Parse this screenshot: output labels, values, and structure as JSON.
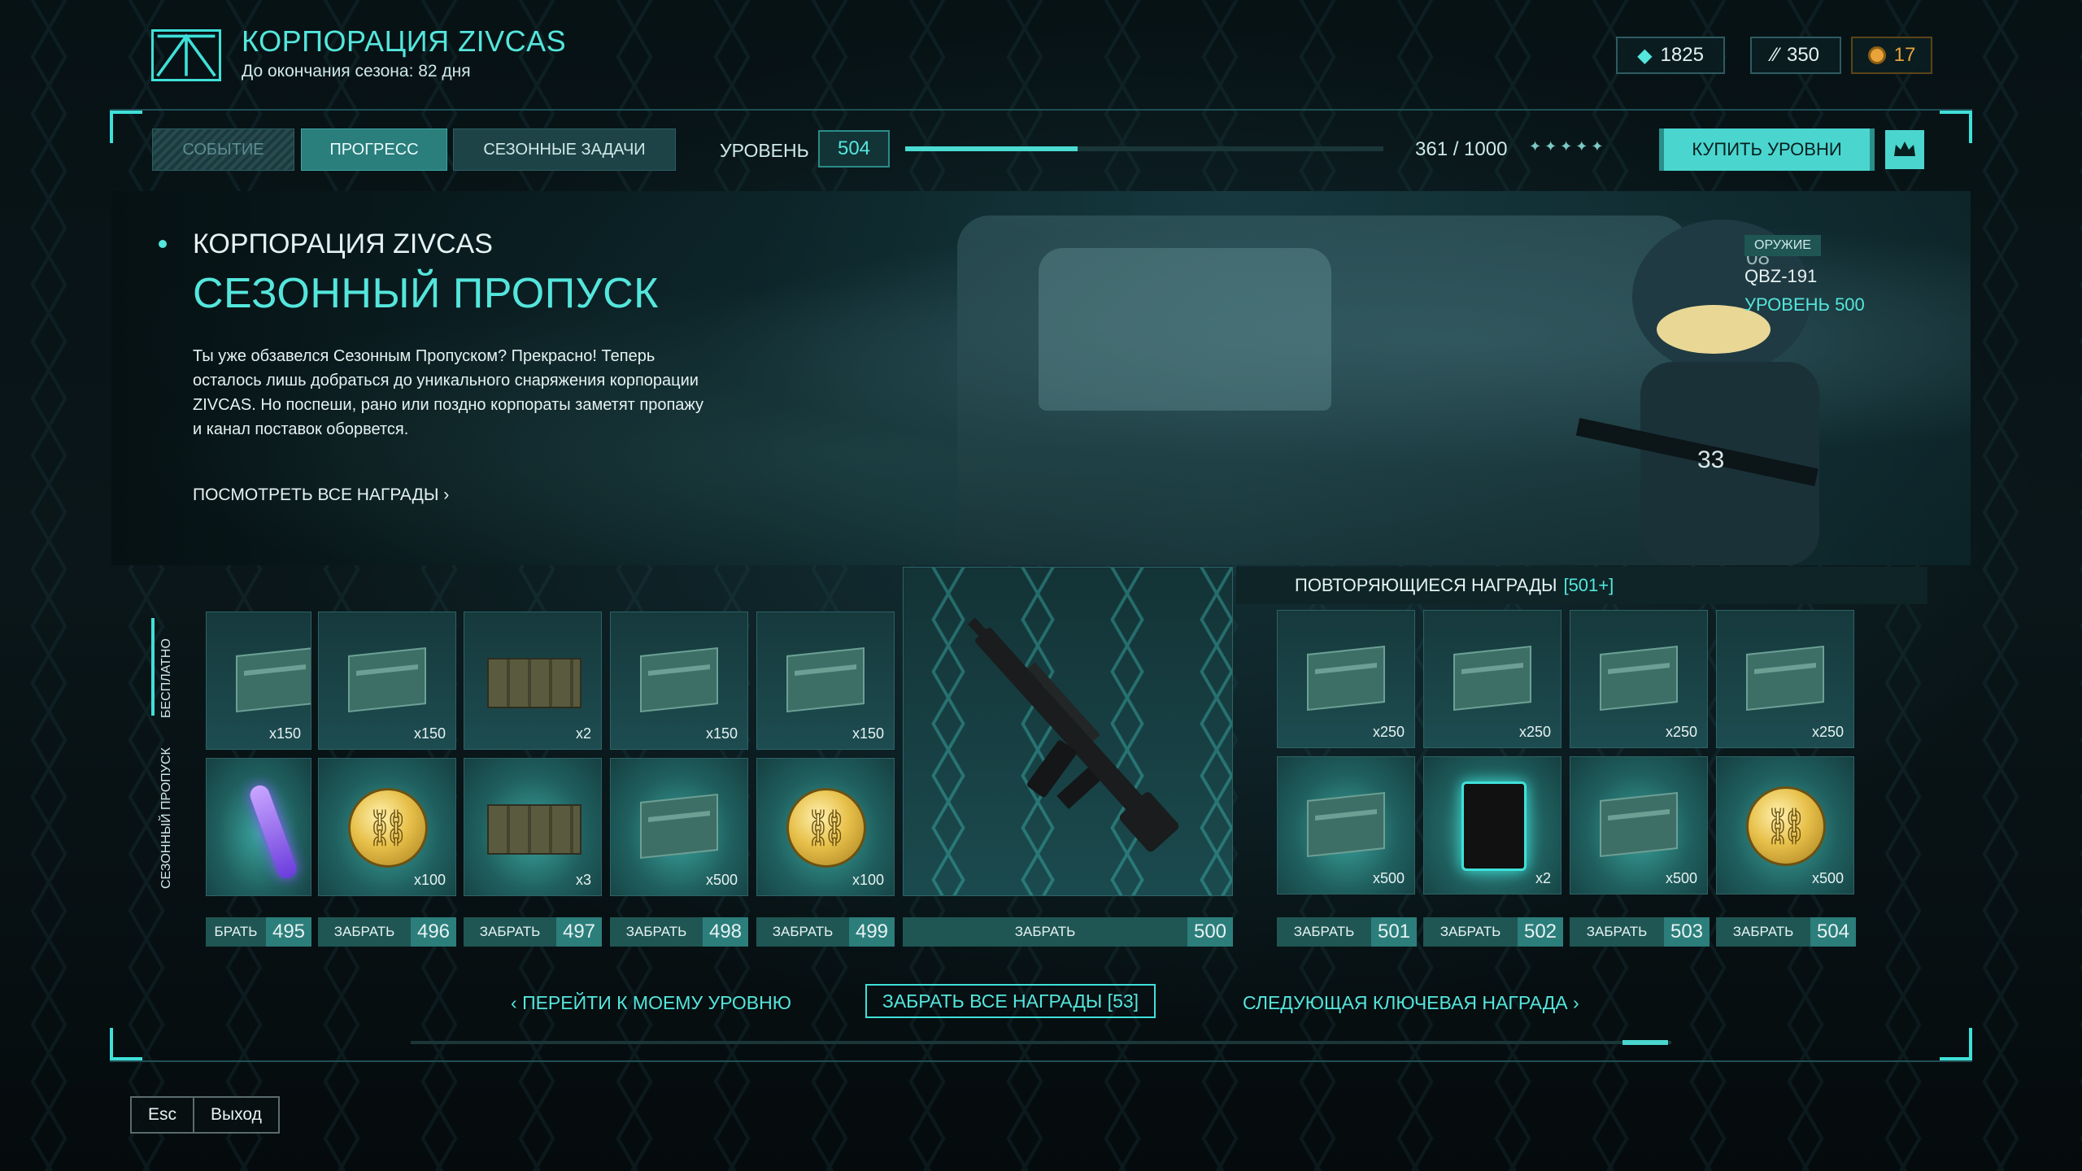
{
  "header": {
    "title": "КОРПОРАЦИЯ ZIVCAS",
    "subtitle": "До окончания сезона: 82 дня",
    "currency": {
      "gems": "1825",
      "tickets": "350",
      "coins": "17"
    }
  },
  "tabs": {
    "event": "СОБЫТИЕ",
    "progress": "ПРОГРЕСС",
    "tasks": "СЕЗОННЫЕ ЗАДАЧИ"
  },
  "level": {
    "label": "УРОВЕНЬ",
    "value": "504",
    "xp_text": "361 / 1000",
    "xp_fraction": 0.361,
    "stars": "✦✦✦✦✦"
  },
  "buy_levels": "КУПИТЬ УРОВНИ",
  "hero": {
    "corp": "КОРПОРАЦИЯ ZIVCAS",
    "title": "СЕЗОННЫЙ ПРОПУСК",
    "description": "Ты уже обзавелся Сезонным Пропуском? Прекрасно! Теперь осталось лишь добраться до уникального снаряжения корпорации ZIVCAS. Но поспеши, рано или поздно корпораты заметят пропажу и канал поставок оборвется.",
    "view_all": "ПОСМОТРЕТЬ ВСЕ НАГРАДЫ",
    "weapon_tag": "ОРУЖИЕ",
    "weapon_name": "QBZ-191",
    "weapon_level": "УРОВЕНЬ 500"
  },
  "side_labels": {
    "free": "БЕСПЛАТНО",
    "pass": "СЕЗОННЫЙ ПРОПУСК"
  },
  "free_row": [
    {
      "qty": "x150",
      "icon": "zivcas-card-icon"
    },
    {
      "qty": "x150",
      "icon": "zivcas-card-icon"
    },
    {
      "qty": "x2",
      "icon": "crate-icon"
    },
    {
      "qty": "x150",
      "icon": "zivcas-card-icon"
    },
    {
      "qty": "x150",
      "icon": "zivcas-card-icon"
    }
  ],
  "pass_row": [
    {
      "qty": "",
      "icon": "glowstick-icon"
    },
    {
      "qty": "x100",
      "icon": "gold-chain-coin-icon"
    },
    {
      "qty": "x3",
      "icon": "crate-icon"
    },
    {
      "qty": "x500",
      "icon": "zivcas-card-icon"
    },
    {
      "qty": "x100",
      "icon": "gold-chain-coin-icon"
    }
  ],
  "claim_label": "ЗАБРАТЬ",
  "claim_first_label": "БРАТЬ",
  "claim_levels": [
    "495",
    "496",
    "497",
    "498",
    "499"
  ],
  "key_reward_level": "500",
  "repeating": {
    "title": "ПОВТОРЯЮЩИЕСЯ НАГРАДЫ",
    "range": "[501+]",
    "free_row": [
      {
        "qty": "x250",
        "icon": "zivcas-card-icon"
      },
      {
        "qty": "x250",
        "icon": "zivcas-card-icon"
      },
      {
        "qty": "x250",
        "icon": "zivcas-card-icon"
      },
      {
        "qty": "x250",
        "icon": "zivcas-card-icon"
      }
    ],
    "pass_row": [
      {
        "qty": "x500",
        "icon": "zivcas-card-icon"
      },
      {
        "qty": "x2",
        "icon": "black-case-icon"
      },
      {
        "qty": "x500",
        "icon": "zivcas-card-icon"
      },
      {
        "qty": "x500",
        "icon": "gold-chain-coin-icon"
      }
    ],
    "claim_levels": [
      "501",
      "502",
      "503",
      "504"
    ]
  },
  "bottom": {
    "goto_level": "ПЕРЕЙТИ К МОЕМУ УРОВНЮ",
    "claim_all": "ЗАБРАТЬ ВСЕ НАГРАДЫ [53]",
    "next_key": "СЛЕДУЮЩАЯ КЛЮЧЕВАЯ НАГРАДА"
  },
  "esc": {
    "key": "Esc",
    "label": "Выход"
  }
}
